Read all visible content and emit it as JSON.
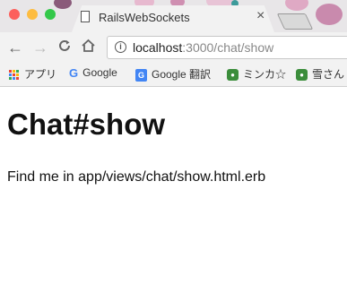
{
  "browser": {
    "tab": {
      "title": "RailsWebSockets",
      "close_glyph": "×"
    },
    "toolbar": {
      "back_glyph": "←",
      "forward_glyph": "→",
      "reload_glyph": "C",
      "home_glyph": "⌂",
      "info_glyph": "i",
      "url_host": "localhost",
      "url_path": ":3000/chat/show"
    },
    "bookmarks": [
      {
        "label": "アプリ",
        "icon": "apps-grid-icon"
      },
      {
        "label": "Google",
        "icon": "google-icon"
      },
      {
        "label": "Google 翻訳",
        "icon": "google-translate-icon"
      },
      {
        "label": "ミンカ☆",
        "icon": "frog-icon"
      },
      {
        "label": "雪さん",
        "icon": "frog-icon"
      }
    ]
  },
  "page": {
    "heading": "Chat#show",
    "message": "Find me in app/views/chat/show.html.erb"
  },
  "colors": {
    "close_light": "#fc605c",
    "minimize_light": "#fdbc40",
    "zoom_light": "#34c84a",
    "theme_blossom": "#d9a7c2"
  }
}
